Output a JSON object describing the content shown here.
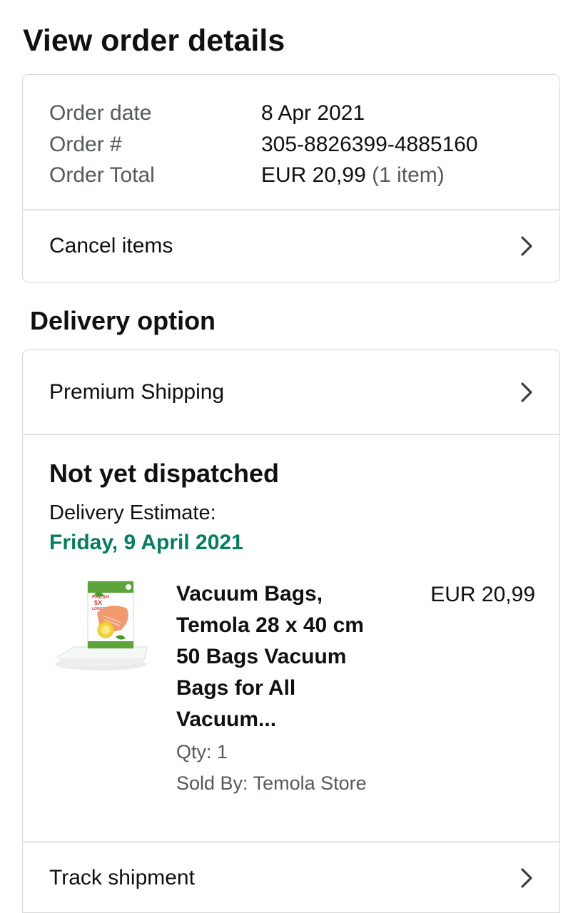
{
  "page": {
    "title": "View order details"
  },
  "summary": {
    "rows": [
      {
        "label": "Order date",
        "value": "8 Apr 2021",
        "extra": ""
      },
      {
        "label": "Order #",
        "value": "305-8826399-4885160",
        "extra": ""
      },
      {
        "label": "Order Total",
        "value": "EUR 20,99",
        "extra": "(1 item)"
      }
    ],
    "cancel_label": "Cancel items"
  },
  "delivery": {
    "section_title": "Delivery option",
    "shipping_method": "Premium Shipping",
    "status": "Not yet dispatched",
    "estimate_label": "Delivery Estimate:",
    "estimate_date": "Friday, 9 April 2021",
    "estimate_color": "#067d62",
    "item": {
      "title": "Vacuum Bags, Temola 28 x 40 cm 50 Bags Vacuum Bags for All Vacuum...",
      "price": "EUR 20,99",
      "qty": "Qty: 1",
      "seller": "Sold By: Temola Store",
      "image_icon": "vacuum-bags-product-image",
      "image_lettering": [
        "FRESH",
        "5X",
        "LONGER"
      ]
    },
    "track_label": "Track shipment"
  },
  "icons": {
    "chevron": "chevron-right-icon"
  }
}
